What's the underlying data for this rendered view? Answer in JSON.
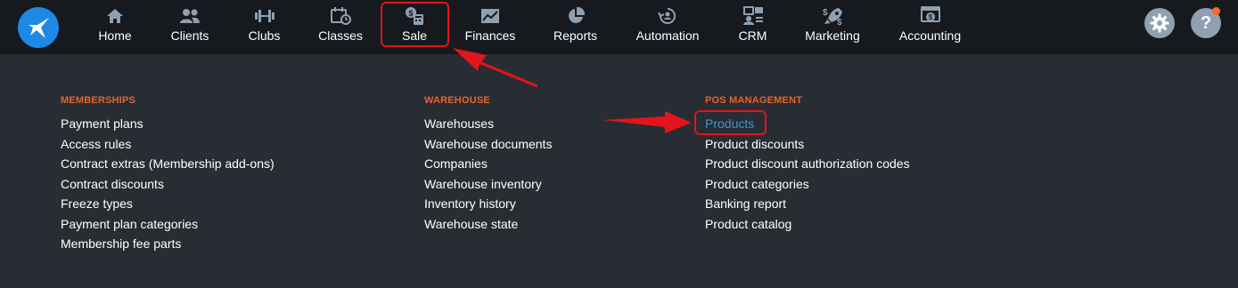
{
  "nav": [
    {
      "id": "home",
      "label": "Home",
      "icon": "home-icon"
    },
    {
      "id": "clients",
      "label": "Clients",
      "icon": "users-icon"
    },
    {
      "id": "clubs",
      "label": "Clubs",
      "icon": "dumbbell-icon"
    },
    {
      "id": "classes",
      "label": "Classes",
      "icon": "calendar-clock-icon"
    },
    {
      "id": "sale",
      "label": "Sale",
      "icon": "cash-register-icon"
    },
    {
      "id": "finances",
      "label": "Finances",
      "icon": "line-chart-icon"
    },
    {
      "id": "reports",
      "label": "Reports",
      "icon": "pie-chart-icon"
    },
    {
      "id": "automation",
      "label": "Automation",
      "icon": "automation-icon"
    },
    {
      "id": "crm",
      "label": "CRM",
      "icon": "crm-icon"
    },
    {
      "id": "marketing",
      "label": "Marketing",
      "icon": "rocket-icon"
    },
    {
      "id": "accounting",
      "label": "Accounting",
      "icon": "accounting-icon"
    }
  ],
  "menu": {
    "memberships": {
      "title": "MEMBERSHIPS",
      "items": [
        "Payment plans",
        "Access rules",
        "Contract extras (Membership add-ons)",
        "Contract discounts",
        "Freeze types",
        "Payment plan categories",
        "Membership fee parts"
      ]
    },
    "warehouse": {
      "title": "WAREHOUSE",
      "items": [
        "Warehouses",
        "Warehouse documents",
        "Companies",
        "Warehouse inventory",
        "Inventory history",
        "Warehouse state"
      ]
    },
    "pos": {
      "title": "POS MANAGEMENT",
      "items": [
        "Products",
        "Product discounts",
        "Product discount authorization codes",
        "Product categories",
        "Banking report",
        "Product catalog"
      ]
    }
  },
  "help_label": "?",
  "colors": {
    "topbar": "#16191d",
    "background": "#282d34",
    "section_title": "#e8622c",
    "active_link": "#3c95d2",
    "highlight": "#e3141b",
    "logo": "#1e88e5",
    "notification": "#ff6a24"
  }
}
